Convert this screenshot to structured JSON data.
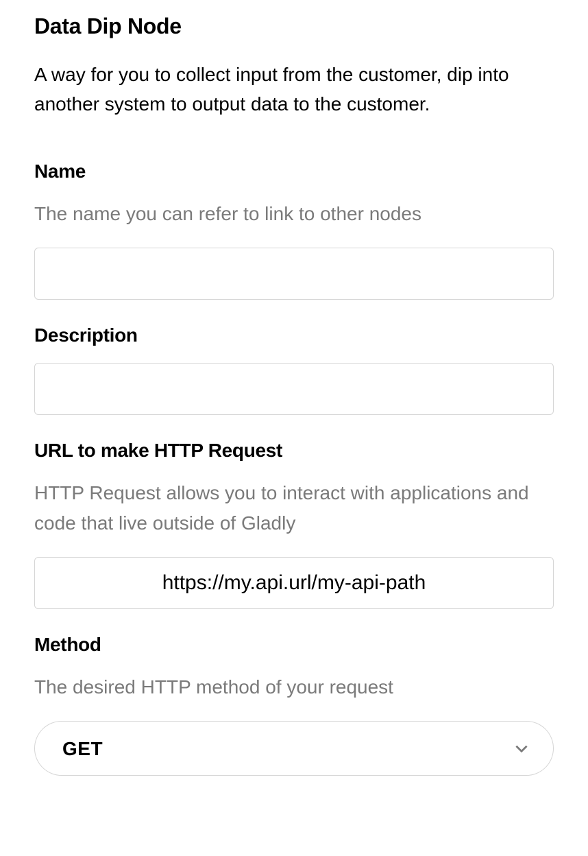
{
  "title": "Data Dip Node",
  "subtitle": "A way for you to collect input from the customer, dip into another system to output data to the customer.",
  "fields": {
    "name": {
      "label": "Name",
      "help": "The name you can refer to link to other nodes",
      "value": ""
    },
    "description": {
      "label": "Description",
      "value": ""
    },
    "url": {
      "label": "URL to make HTTP Request",
      "help": "HTTP Request allows you to interact with applications and code that live outside of Gladly",
      "value": "https://my.api.url/my-api-path"
    },
    "method": {
      "label": "Method",
      "help": "The desired HTTP method of your request",
      "value": "GET"
    }
  }
}
